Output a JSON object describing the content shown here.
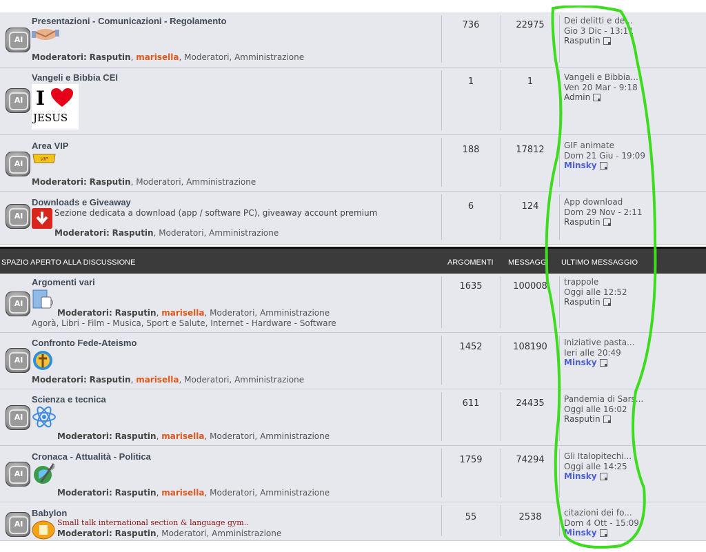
{
  "rows_top": [
    {
      "title": "Presentazioni - Comunicazioni - Regolamento",
      "topics": "736",
      "posts": "22975",
      "last_title": "Dei delitti e de...",
      "last_date": "Gio 3 Dic - 13:11",
      "last_user": "Rasputin",
      "mods_label": "Moderatori:",
      "mods": [
        "Rasputin",
        "marisella",
        "Moderatori",
        "Amministrazione"
      ]
    },
    {
      "title": "Vangeli e Bibbia CEI",
      "topics": "1",
      "posts": "1",
      "last_title": "Vangeli e Bibbia...",
      "last_date": "Ven 20 Mar - 9:18",
      "last_user": "Admin",
      "icon_text_top": "I",
      "icon_text_bottom": "JESUS"
    },
    {
      "title": "Area VIP",
      "topics": "188",
      "posts": "17812",
      "last_title": "GIF animate",
      "last_date": "Dom 21 Giu - 19:09",
      "last_user": "Minsky",
      "mods_label": "Moderatori:",
      "mods": [
        "Rasputin",
        "Moderatori",
        "Amministrazione"
      ],
      "vip_text": "VIP"
    },
    {
      "title": "Downloads e Giveaway",
      "desc": "Sezione dedicata a download (app / software PC), giveaway account premium",
      "topics": "6",
      "posts": "124",
      "last_title": "App download",
      "last_date": "Dom 29 Nov - 2:11",
      "last_user": "Rasputin",
      "mods_label": "Moderatori:",
      "mods": [
        "Rasputin",
        "Moderatori",
        "Amministrazione"
      ]
    }
  ],
  "header": {
    "section": "SPAZIO APERTO ALLA DISCUSSIONE",
    "topics": "ARGOMENTI",
    "posts": "MESSAGGI",
    "last": "ULTIMO MESSAGGIO"
  },
  "rows_bottom": [
    {
      "title": "Argomenti vari",
      "topics": "1635",
      "posts": "100008",
      "last_title": "trappole",
      "last_date": "Oggi alle 12:52",
      "last_user": "Rasputin",
      "mods_label": "Moderatori:",
      "mods": [
        "Rasputin",
        "marisella",
        "Moderatori",
        "Amministrazione"
      ],
      "subforums": "Agorà, Libri - Film - Musica, Sport e Salute, Internet - Hardware - Software"
    },
    {
      "title": "Confronto Fede-Ateismo",
      "topics": "1452",
      "posts": "108190",
      "last_title": "Iniziative pasta...",
      "last_date": "Ieri alle 20:49",
      "last_user": "Minsky",
      "mods_label": "Moderatori:",
      "mods": [
        "Rasputin",
        "marisella",
        "Moderatori",
        "Amministrazione"
      ]
    },
    {
      "title": "Scienza e tecnica",
      "topics": "611",
      "posts": "24435",
      "last_title": "Pandemia di Sars...",
      "last_date": "Oggi alle 16:02",
      "last_user": "Rasputin",
      "mods_label": "Moderatori:",
      "mods": [
        "Rasputin",
        "marisella",
        "Moderatori",
        "Amministrazione"
      ]
    },
    {
      "title": "Cronaca - Attualità - Politica",
      "topics": "1759",
      "posts": "74294",
      "last_title": "Gli Italopitechi...",
      "last_date": "Oggi alle 14:25",
      "last_user": "Minsky",
      "mods_label": "Moderatori:",
      "mods": [
        "Rasputin",
        "marisella",
        "Moderatori",
        "Amministrazione"
      ]
    },
    {
      "title": "Babylon",
      "desc": "Small talk international section & language gym..",
      "topics": "55",
      "posts": "2538",
      "last_title": "citazioni dei fo...",
      "last_date": "Dom 4 Ott - 15:09",
      "last_user": "Minsky",
      "mods_label": "Moderatori:",
      "mods": [
        "Rasputin",
        "Moderatori",
        "Amministrazione"
      ]
    }
  ],
  "status_icon_text": "AI",
  "colors": {
    "row_bg": "#e7e8ee",
    "header_bg": "#3b3b3b",
    "moderator_highlight": "#e0571b",
    "user_blue": "#4c5fd6",
    "annotation_green": "#3ddc1f"
  }
}
